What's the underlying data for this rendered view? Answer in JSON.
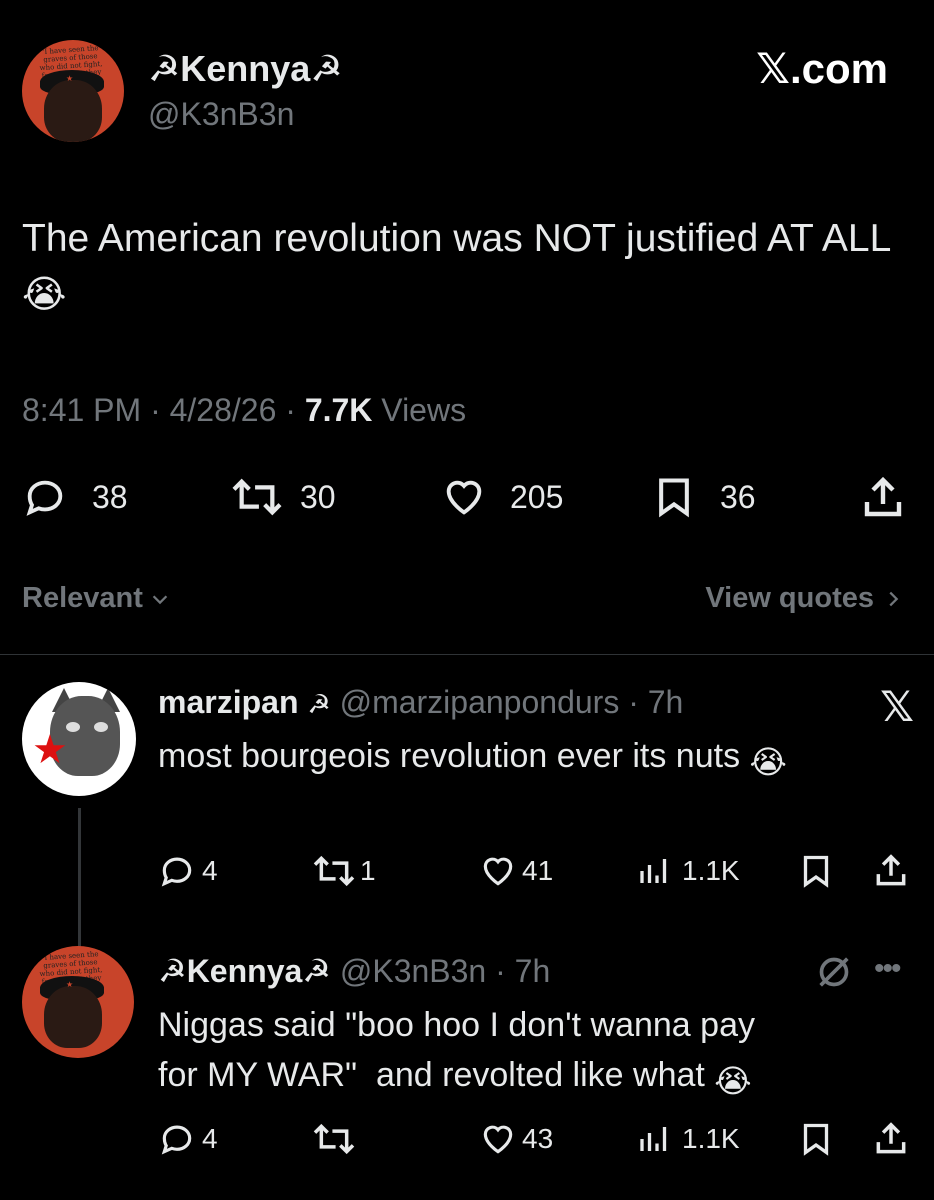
{
  "main_post": {
    "display_name": "☭Kennya☭",
    "handle": "@K3nB3n",
    "brand": "𝕏.com",
    "text": "The American revolution was NOT justified AT ALL",
    "emoji": "😭",
    "time": "8:41 PM",
    "date": "4/28/26",
    "views_count": "7.7K",
    "views_label": "Views",
    "replies": "38",
    "reposts": "30",
    "likes": "205",
    "bookmarks": "36",
    "avatar_quote": "\"I have seen the graves of those who did not fight, fearing that they would die\""
  },
  "sort": {
    "label": "Relevant",
    "view_quotes": "View quotes"
  },
  "reply1": {
    "display_name": "marzipan",
    "flag": "☭",
    "handle": "@marzipanpondurs",
    "time": "7h",
    "text": "most bourgeois revolution ever its nuts",
    "emoji": "😭",
    "replies": "4",
    "reposts": "1",
    "likes": "41",
    "views": "1.1K"
  },
  "reply2": {
    "display_name": "☭Kennya☭",
    "handle": "@K3nB3n",
    "time": "7h",
    "text_line1": "Niggas said \"boo hoo I don't wanna pay",
    "text_line2": "for MY WAR\"  and revolted like what",
    "emoji": "😭",
    "replies": "4",
    "reposts": "",
    "likes": "43",
    "views": "1.1K"
  },
  "colors": {
    "background": "#000000",
    "text": "#e7e9ea",
    "muted": "#71767b",
    "divider": "#2f3336"
  }
}
